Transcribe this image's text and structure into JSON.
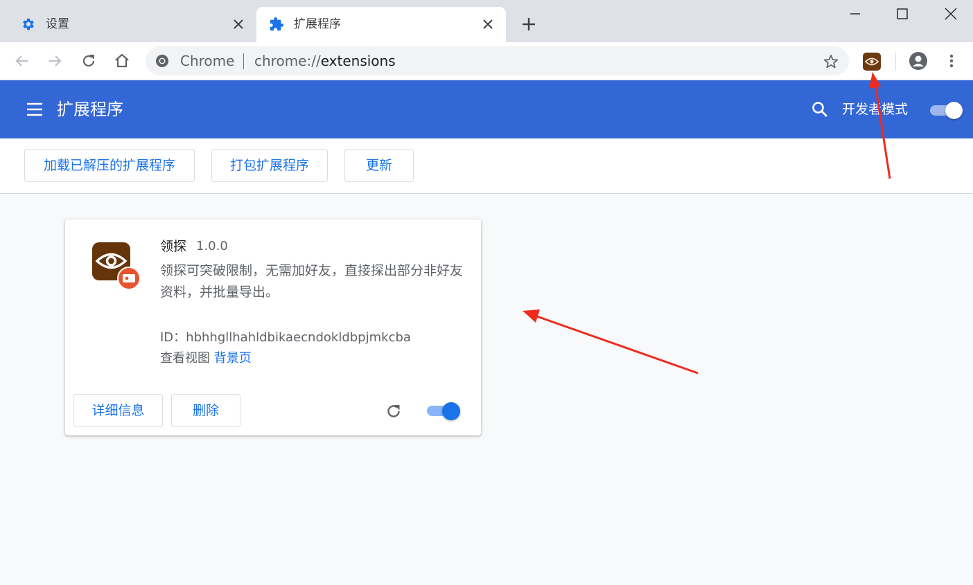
{
  "tabs": [
    {
      "title": "设置",
      "icon": "gear-icon",
      "active": false
    },
    {
      "title": "扩展程序",
      "icon": "puzzle-icon",
      "active": true
    }
  ],
  "omnibox": {
    "site_label": "Chrome",
    "url_scheme": "chrome://",
    "url_path": "extensions"
  },
  "header": {
    "title": "扩展程序",
    "dev_mode_label": "开发者模式",
    "dev_mode_on": true
  },
  "actions": {
    "load_unpacked": "加载已解压的扩展程序",
    "pack": "打包扩展程序",
    "update": "更新"
  },
  "extension": {
    "name": "领探",
    "version": "1.0.0",
    "description": "领探可突破限制，无需加好友，直接探出部分非好友资料，并批量导出。",
    "id_label": "ID：",
    "id": "hbhhgllhahldbikaecndokldbpjmkcba",
    "views_label": "查看视图",
    "views_link": "背景页",
    "details_button": "详细信息",
    "remove_button": "删除",
    "enabled": true
  },
  "colors": {
    "header_blue": "#3367d6",
    "link_blue": "#1a73e8",
    "icon_brown": "#653408",
    "badge_orange": "#e8542e",
    "annotation_red": "#f02a1e"
  }
}
